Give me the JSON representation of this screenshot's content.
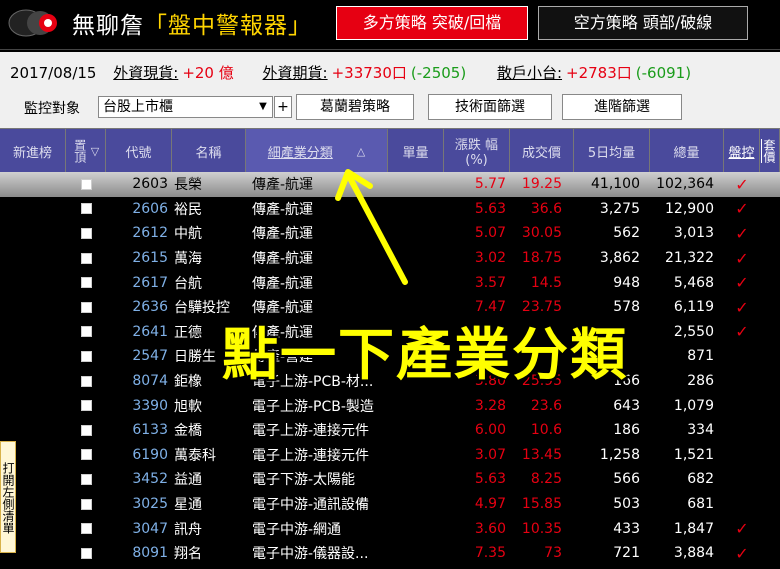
{
  "header": {
    "title_main": "無聊詹",
    "title_highlight": "「盤中警報器」",
    "long_button": "多方策略  突破/回檔",
    "short_button": "空方策略  頭部/破線"
  },
  "info": {
    "date": "2017/08/15",
    "foreign_spot_label": "外資現貨:",
    "foreign_spot_value": "+20 億",
    "foreign_futures_label": "外資期貨:",
    "foreign_futures_value": "+33730口",
    "foreign_futures_change": "(-2505)",
    "retail_label": "散戶小台:",
    "retail_value": "+2783口",
    "retail_change": "(-6091)",
    "monitor_label": "監控對象",
    "monitor_select": "台股上市櫃",
    "plus": "+",
    "btn_strategy": "葛蘭碧策略",
    "btn_tech": "技術面篩選",
    "btn_adv": "進階篩選"
  },
  "columns": {
    "new": "新進榜",
    "pin": "置頂",
    "pin_arrow": "▽",
    "code": "代號",
    "name": "名稱",
    "industry": "細產業分類",
    "industry_arrow": "△",
    "volume": "單量",
    "change": "漲跌 幅 (%)",
    "price": "成交價",
    "avg5": "5日均量",
    "total": "總量",
    "watch": "盤控",
    "extra": "套價"
  },
  "rows": [
    {
      "code": "2603",
      "name": "長榮",
      "industry": "傳產-航運",
      "change": "5.77",
      "price": "19.25",
      "avg5": "41,100",
      "total": "102,364",
      "check": "✓"
    },
    {
      "code": "2606",
      "name": "裕民",
      "industry": "傳產-航運",
      "change": "5.63",
      "price": "36.6",
      "avg5": "3,275",
      "total": "12,900",
      "check": "✓"
    },
    {
      "code": "2612",
      "name": "中航",
      "industry": "傳產-航運",
      "change": "5.07",
      "price": "30.05",
      "avg5": "562",
      "total": "3,013",
      "check": "✓"
    },
    {
      "code": "2615",
      "name": "萬海",
      "industry": "傳產-航運",
      "change": "3.02",
      "price": "18.75",
      "avg5": "3,862",
      "total": "21,322",
      "check": "✓"
    },
    {
      "code": "2617",
      "name": "台航",
      "industry": "傳產-航運",
      "change": "3.57",
      "price": "14.5",
      "avg5": "948",
      "total": "5,468",
      "check": "✓"
    },
    {
      "code": "2636",
      "name": "台驊投控",
      "industry": "傳產-航運",
      "change": "7.47",
      "price": "23.75",
      "avg5": "578",
      "total": "6,119",
      "check": "✓"
    },
    {
      "code": "2641",
      "name": "正德",
      "industry": "傳產-航運",
      "change": "",
      "price": "",
      "avg5": "",
      "total": "2,550",
      "check": "✓"
    },
    {
      "code": "2547",
      "name": "日勝生",
      "industry": "傳產-營建",
      "change": "",
      "price": "",
      "avg5": "",
      "total": "871",
      "check": ""
    },
    {
      "code": "8074",
      "name": "鉅橡",
      "industry": "電子上游-PCB-材...",
      "change": "3.80",
      "price": "25.95",
      "avg5": "166",
      "total": "286",
      "check": ""
    },
    {
      "code": "3390",
      "name": "旭軟",
      "industry": "電子上游-PCB-製造",
      "change": "3.28",
      "price": "23.6",
      "avg5": "643",
      "total": "1,079",
      "check": ""
    },
    {
      "code": "6133",
      "name": "金橋",
      "industry": "電子上游-連接元件",
      "change": "6.00",
      "price": "10.6",
      "avg5": "186",
      "total": "334",
      "check": ""
    },
    {
      "code": "6190",
      "name": "萬泰科",
      "industry": "電子上游-連接元件",
      "change": "3.07",
      "price": "13.45",
      "avg5": "1,258",
      "total": "1,521",
      "check": ""
    },
    {
      "code": "3452",
      "name": "益通",
      "industry": "電子下游-太陽能",
      "change": "5.63",
      "price": "8.25",
      "avg5": "566",
      "total": "682",
      "check": ""
    },
    {
      "code": "3025",
      "name": "星通",
      "industry": "電子中游-通訊設備",
      "change": "4.97",
      "price": "15.85",
      "avg5": "503",
      "total": "681",
      "check": ""
    },
    {
      "code": "3047",
      "name": "訊舟",
      "industry": "電子中游-網通",
      "change": "3.60",
      "price": "10.35",
      "avg5": "433",
      "total": "1,847",
      "check": "✓"
    },
    {
      "code": "8091",
      "name": "翔名",
      "industry": "電子中游-儀器設...",
      "change": "7.35",
      "price": "73",
      "avg5": "721",
      "total": "3,884",
      "check": "✓"
    }
  ],
  "annotation": "點一下產業分類",
  "side_tab": "打開左側清單",
  "colors": {
    "accent_red": "#e60012",
    "header_blue": "#4a4a9c",
    "annotation_yellow": "#ffff00",
    "positive_green": "#1a9c1a"
  }
}
